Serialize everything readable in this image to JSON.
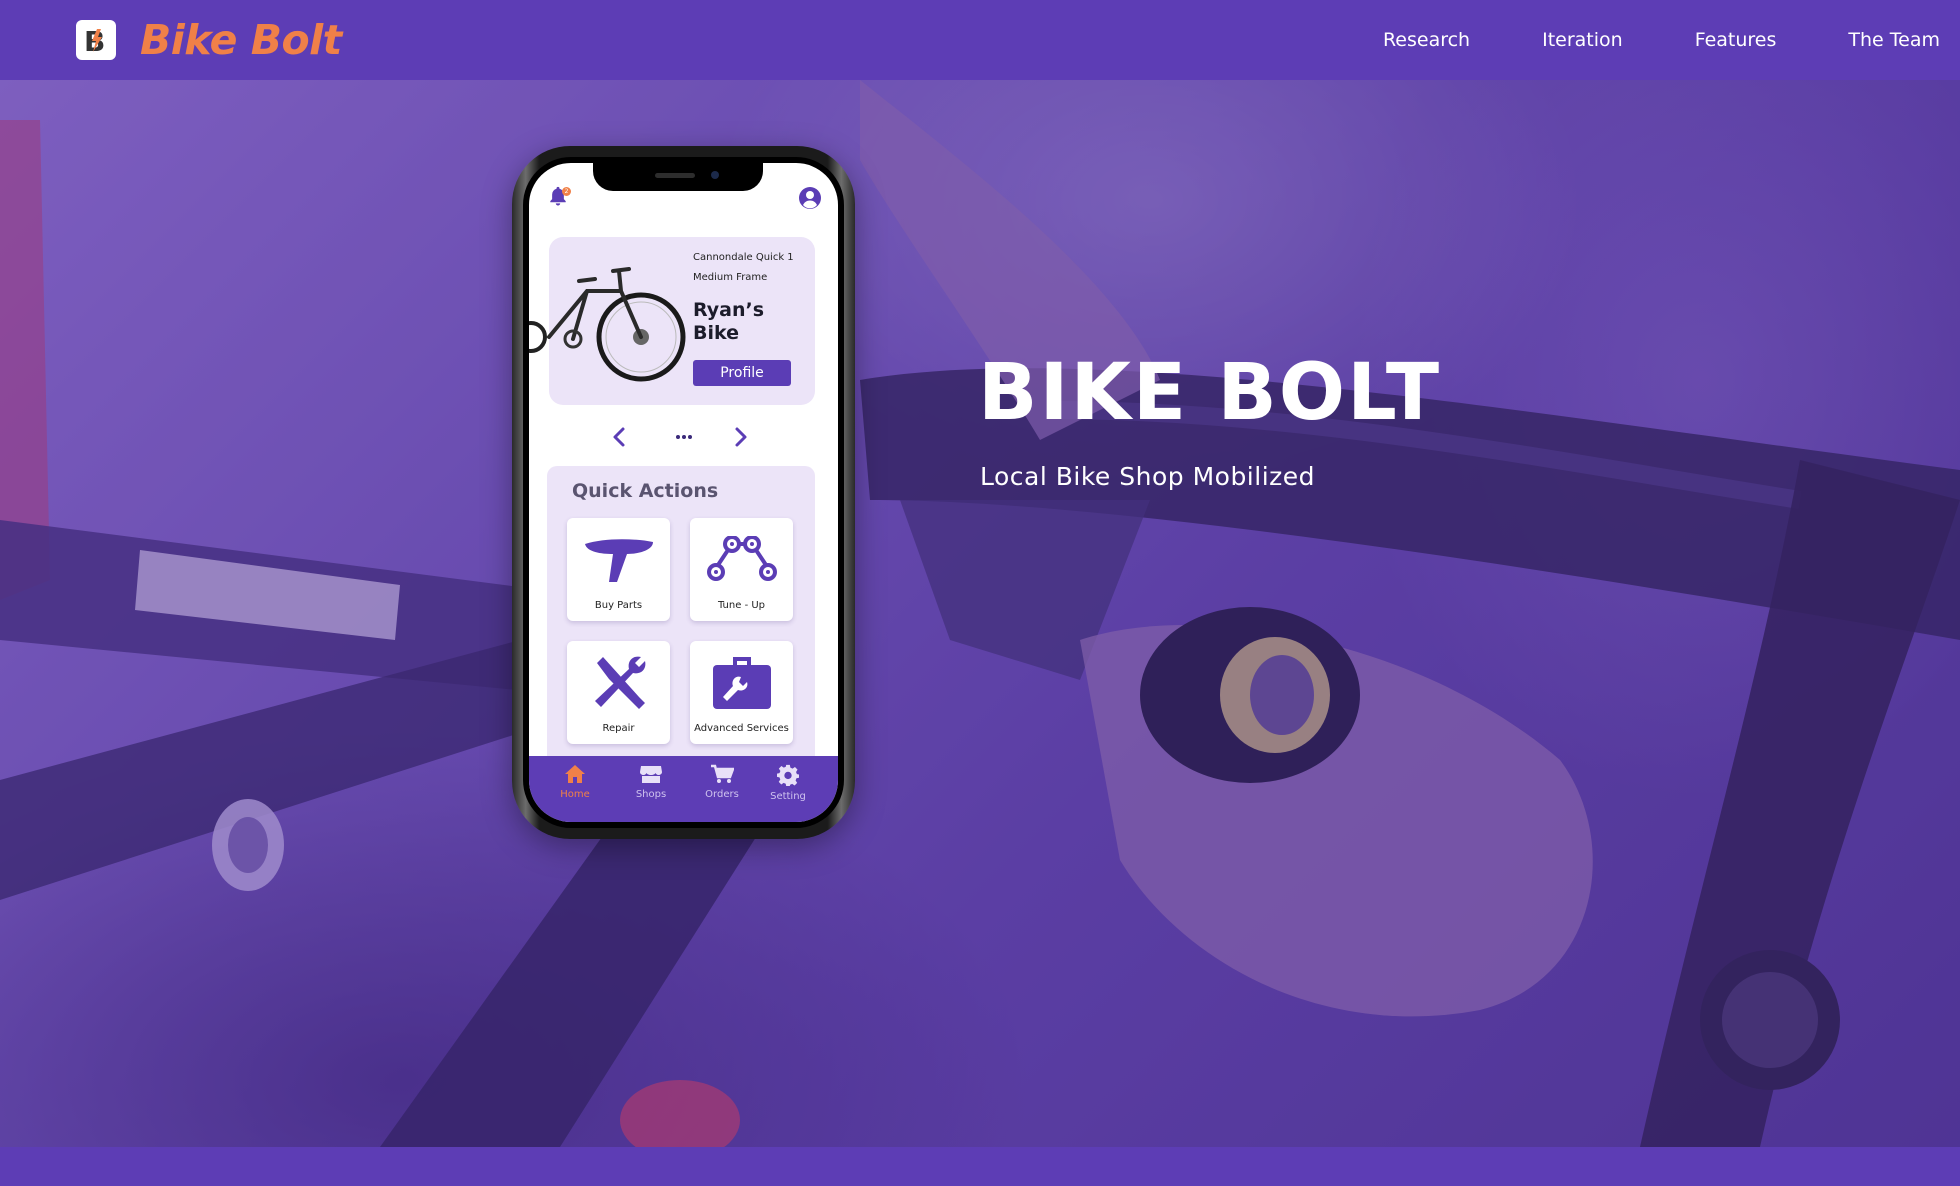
{
  "brand": {
    "name": "Bike Bolt",
    "logo_icon": "bolt-b-logo-icon",
    "name_color": "#f08048"
  },
  "nav": {
    "links": [
      "Research",
      "Iteration",
      "Features",
      "The Team"
    ]
  },
  "hero": {
    "title": "BIKE BOLT",
    "subtitle": "Local Bike Shop Mobilized",
    "overlay_color": "#5c3cb4"
  },
  "phone": {
    "header": {
      "notification_icon": "bell-icon",
      "notification_badge": "2",
      "account_icon": "user-circle-icon"
    },
    "bike_card": {
      "model": "Cannondale Quick 1",
      "frame": "Medium Frame",
      "name": "Ryan’s Bike",
      "profile_button": "Profile"
    },
    "pager": {
      "prev_icon": "chevron-left-icon",
      "dots": "•••",
      "next_icon": "chevron-right-icon"
    },
    "quick_actions": {
      "title": "Quick Actions",
      "items": [
        {
          "label": "Buy Parts",
          "icon": "bike-seat-icon"
        },
        {
          "label": "Tune - Up",
          "icon": "bike-chain-icon"
        },
        {
          "label": "Repair",
          "icon": "wrench-screwdriver-icon"
        },
        {
          "label": "Advanced Services",
          "icon": "toolbox-icon"
        }
      ]
    },
    "tabbar": {
      "active": "Home",
      "tabs": [
        {
          "label": "Home",
          "icon": "home-icon"
        },
        {
          "label": "Shops",
          "icon": "store-icon"
        },
        {
          "label": "Orders",
          "icon": "cart-icon"
        },
        {
          "label": "Setting",
          "icon": "gear-icon"
        }
      ]
    }
  },
  "colors": {
    "brand_purple": "#5d3db5",
    "accent_orange": "#f08048",
    "card_lavender": "#ece4f8"
  }
}
